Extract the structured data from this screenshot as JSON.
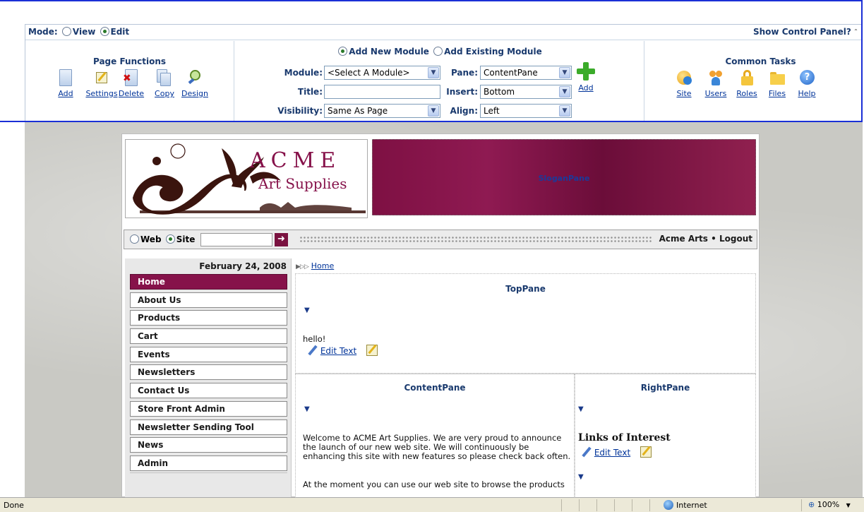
{
  "control_panel": {
    "mode_label": "Mode:",
    "mode_view": "View",
    "mode_edit": "Edit",
    "show_label": "Show Control Panel?",
    "page_functions": {
      "title": "Page Functions",
      "items": [
        "Add",
        "Settings",
        "Delete",
        "Copy",
        "Design"
      ]
    },
    "module": {
      "add_new": "Add New Module",
      "add_existing": "Add Existing Module",
      "module_label": "Module:",
      "module_value": "<Select A Module>",
      "title_label": "Title:",
      "title_value": "",
      "visibility_label": "Visibility:",
      "visibility_value": "Same As Page",
      "pane_label": "Pane:",
      "pane_value": "ContentPane",
      "insert_label": "Insert:",
      "insert_value": "Bottom",
      "align_label": "Align:",
      "align_value": "Left",
      "add_label": "Add"
    },
    "common_tasks": {
      "title": "Common Tasks",
      "items": [
        "Site",
        "Users",
        "Roles",
        "Files",
        "Help"
      ]
    }
  },
  "site": {
    "logo_title": "ACME",
    "logo_subtitle": "Art Supplies",
    "slogan_pane": "SloganPane",
    "search_web": "Web",
    "search_site": "Site",
    "search_value": "",
    "user_name": "Acme Arts",
    "separator": "•",
    "logout": "Logout",
    "date": "February 24, 2008",
    "nav": [
      "Home",
      "About Us",
      "Products",
      "Cart",
      "Events",
      "Newsletters",
      "Contact Us",
      "Store Front Admin",
      "Newsletter Sending Tool",
      "News",
      "Admin"
    ],
    "breadcrumb": "Home",
    "top_pane": {
      "title": "TopPane",
      "text": "hello!",
      "edit": "Edit Text"
    },
    "content_pane": {
      "title": "ContentPane",
      "text1": "Welcome to ACME Art Supplies.  We are very proud to announce the launch of our new web site.  We will continuously be enhancing this site with new features so please check back often.",
      "text2": "At the moment you can use our web site to browse the products"
    },
    "right_pane": {
      "title": "RightPane",
      "links_title": "Links of Interest",
      "edit": "Edit Text"
    }
  },
  "status": {
    "left": "Done",
    "zone": "Internet",
    "zoom": "100%"
  }
}
